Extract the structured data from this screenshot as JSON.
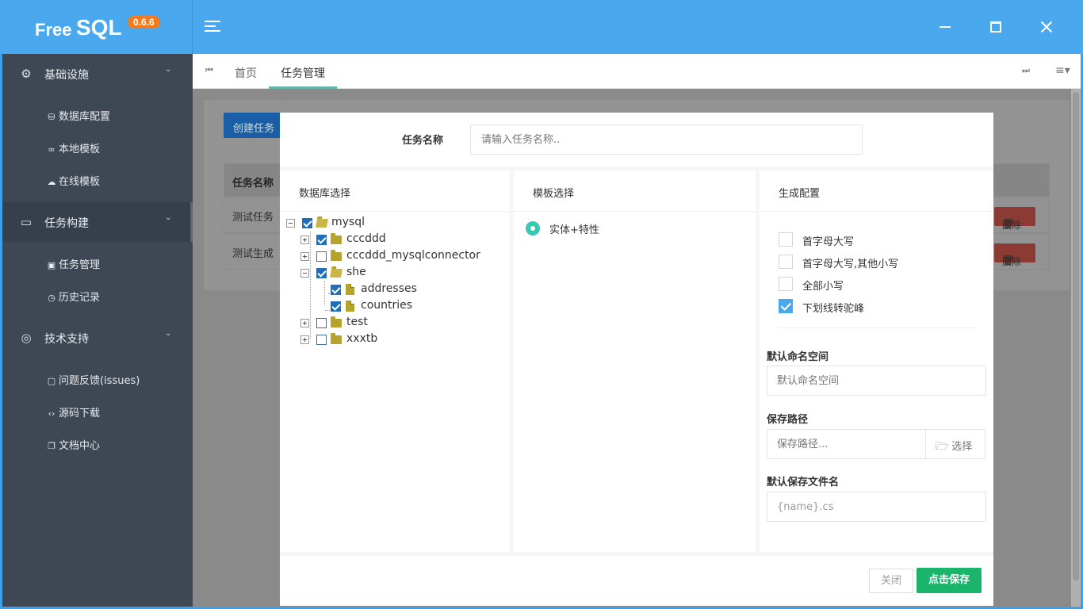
{
  "app": {
    "name_part1": "Free",
    "name_part2": "SQL",
    "version": "0.6.6"
  },
  "sidebar": {
    "groups": [
      {
        "label": "基础设施",
        "icon": "gear-icon",
        "items": [
          {
            "label": "数据库配置",
            "icon": "database-icon"
          },
          {
            "label": "本地模板",
            "icon": "link-icon"
          },
          {
            "label": "在线模板",
            "icon": "cloud-icon"
          }
        ]
      },
      {
        "label": "任务构建",
        "icon": "window-icon",
        "items": [
          {
            "label": "任务管理",
            "icon": "calendar-check-icon"
          },
          {
            "label": "历史记录",
            "icon": "history-icon"
          }
        ]
      },
      {
        "label": "技术支持",
        "icon": "fingerprint-icon",
        "items": [
          {
            "label": "问题反馈(issues)",
            "icon": "comment-icon"
          },
          {
            "label": "源码下载",
            "icon": "code-icon"
          },
          {
            "label": "文档中心",
            "icon": "copy-icon"
          }
        ]
      }
    ]
  },
  "tabs": [
    {
      "label": "首页"
    },
    {
      "label": "任务管理"
    }
  ],
  "background": {
    "create_button": "创建任务",
    "table_header": "任务名称",
    "rows": [
      {
        "name": "测试任务"
      },
      {
        "name": "测试生成"
      }
    ],
    "delete_label": "删除"
  },
  "modal": {
    "task_name_label": "任务名称",
    "task_name_placeholder": "请输入任务名称..",
    "db_select_title": "数据库选择",
    "template_select_title": "模板选择",
    "gen_config_title": "生成配置",
    "tree": {
      "root": "mysql",
      "children": [
        {
          "label": "cccddd"
        },
        {
          "label": "cccddd_mysqlconnector"
        },
        {
          "label": "she",
          "children": [
            {
              "label": "addresses"
            },
            {
              "label": "countries"
            }
          ]
        },
        {
          "label": "test"
        },
        {
          "label": "xxxtb"
        }
      ]
    },
    "template_option": "实体+特性",
    "naming_options": [
      {
        "label": "首字母大写",
        "checked": false
      },
      {
        "label": "首字母大写,其他小写",
        "checked": false
      },
      {
        "label": "全部小写",
        "checked": false
      },
      {
        "label": "下划线转驼峰",
        "checked": true
      }
    ],
    "namespace_label": "默认命名空间",
    "namespace_placeholder": "默认命名空间",
    "save_path_label": "保存路径",
    "save_path_placeholder": "保存路径...",
    "select_button": "选择",
    "filename_label": "默认保存文件名",
    "filename_value": "{name}.cs",
    "close_button": "关闭",
    "save_button": "点击保存"
  },
  "colors": {
    "header": "#4aa9ee",
    "sidebar": "#3e4855",
    "accent": "#3ac8b0",
    "save": "#1ab46a",
    "checkbox": "#1f6fb9"
  }
}
